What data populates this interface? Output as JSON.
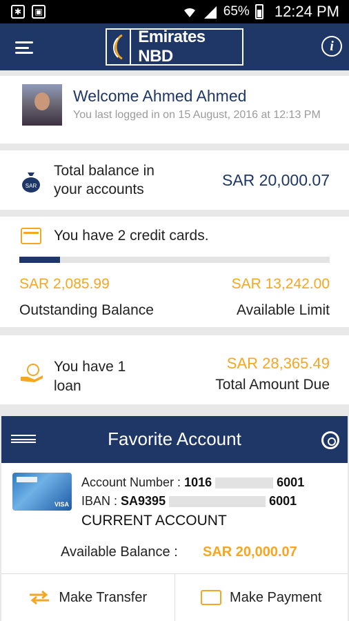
{
  "status_bar": {
    "battery": "65%",
    "time": "12:24 PM"
  },
  "app_bar": {
    "brand": "Emirates NBD"
  },
  "welcome": {
    "title": "Welcome Ahmed Ahmed",
    "last_login": "You last logged in on 15 August, 2016 at 12:13 PM"
  },
  "balance": {
    "label_line1": "Total balance in",
    "label_line2": "your accounts",
    "value": "SAR 20,000.07"
  },
  "credit_cards": {
    "summary": "You have 2 credit cards.",
    "usage_fraction": 0.13,
    "outstanding_value": "SAR 2,085.99",
    "outstanding_label": "Outstanding Balance",
    "limit_value": "SAR 13,242.00",
    "limit_label": "Available Limit"
  },
  "loan": {
    "text_line1": "You have 1",
    "text_line2": "loan",
    "amount": "SAR 28,365.49",
    "amount_label": "Total Amount Due"
  },
  "favorite": {
    "title": "Favorite Account",
    "account_number_label": "Account Number :",
    "account_number_start": "1016",
    "account_number_end": "6001",
    "iban_label": "IBAN :",
    "iban_start": "SA9395",
    "iban_end": "6001",
    "account_type": "CURRENT ACCOUNT",
    "available_label": "Available Balance :",
    "available_value": "SAR 20,000.07"
  },
  "actions": {
    "transfer": "Make Transfer",
    "payment": "Make Payment"
  },
  "colors": {
    "brand": "#1e3766",
    "accent": "#f5a623"
  }
}
